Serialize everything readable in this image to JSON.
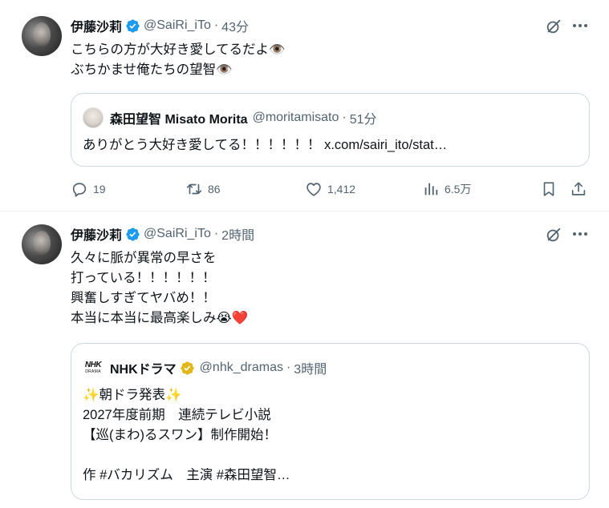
{
  "tweets": [
    {
      "name": "伊藤沙莉",
      "handle": "@SaiRi_iTo",
      "sep": "·",
      "time": "43分",
      "lines": [
        "こちらの方が大好き愛してるだよ👁️",
        "ぶちかませ俺たちの望智👁️"
      ],
      "quote": {
        "name": "森田望智 Misato Morita",
        "handle": "@moritamisato",
        "sep": "·",
        "time": "51分",
        "lines": [
          "ありがとう大好き愛してる！！！！！！ x.com/sairi_ito/stat…"
        ]
      },
      "actions": {
        "replies": "19",
        "reposts": "86",
        "likes": "1,412",
        "views": "6.5万"
      }
    },
    {
      "name": "伊藤沙莉",
      "handle": "@SaiRi_iTo",
      "sep": "·",
      "time": "2時間",
      "lines": [
        "久々に脈が異常の早さを",
        "打っている！！！！！！",
        "興奮しすぎてヤバめ！！",
        "本当に本当に最高楽しみ😭❤️"
      ],
      "quote": {
        "logo_top": "NHK",
        "logo_bottom": "DRAMA",
        "name": "NHKドラマ",
        "handle": "@nhk_dramas",
        "sep": "·",
        "time": "3時間",
        "lines": [
          "✨朝ドラ発表✨",
          "2027年度前期　連続テレビ小説",
          "【巡(まわ)るスワン】制作開始！",
          "",
          "作 #バカリズム　主演 #森田望智…"
        ]
      }
    }
  ],
  "colors": {
    "verified_blue": "#1d9bf0",
    "gold_badge": "#e2b719",
    "secondary_text": "#536471",
    "border": "#cfd9de"
  },
  "icons": [
    "verified-badge-icon",
    "grok-icon",
    "more-icon",
    "reply-icon",
    "repost-icon",
    "like-icon",
    "views-icon",
    "bookmark-icon",
    "share-icon",
    "gold-verified-badge-icon"
  ]
}
